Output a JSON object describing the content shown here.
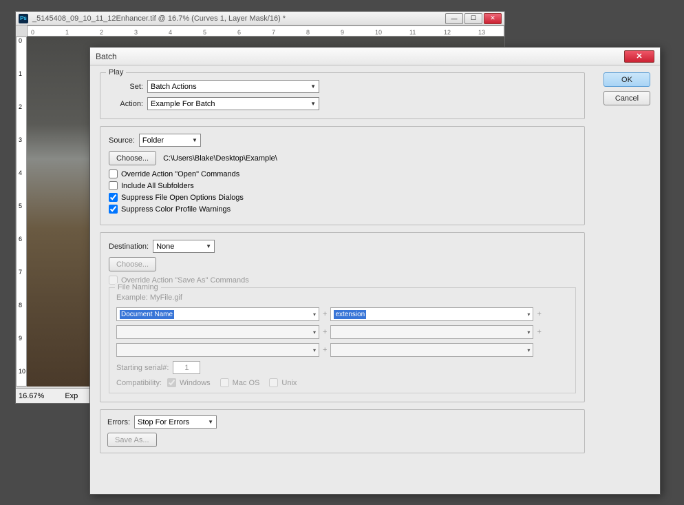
{
  "doc": {
    "title": "_5145408_09_10_11_12Enhancer.tif @ 16.7% (Curves 1, Layer Mask/16) *",
    "zoom": "16.67%",
    "status2": "Exp"
  },
  "ruler_h": [
    "0",
    "1",
    "2",
    "3",
    "4",
    "5",
    "6",
    "7",
    "8",
    "9",
    "10",
    "11",
    "12",
    "13"
  ],
  "ruler_v": [
    "0",
    "1",
    "2",
    "3",
    "4",
    "5",
    "6",
    "7",
    "8",
    "9",
    "10"
  ],
  "dlg": {
    "title": "Batch",
    "ok": "OK",
    "cancel": "Cancel",
    "play": {
      "legend": "Play",
      "set_label": "Set:",
      "set_value": "Batch Actions",
      "action_label": "Action:",
      "action_value": "Example For Batch"
    },
    "source": {
      "label": "Source:",
      "value": "Folder",
      "choose": "Choose...",
      "path": "C:\\Users\\Blake\\Desktop\\Example\\",
      "cb1": "Override Action \"Open\" Commands",
      "cb2": "Include All Subfolders",
      "cb3": "Suppress File Open Options Dialogs",
      "cb4": "Suppress Color Profile Warnings"
    },
    "dest": {
      "label": "Destination:",
      "value": "None",
      "choose": "Choose...",
      "cb1": "Override Action \"Save As\" Commands",
      "naming_legend": "File Naming",
      "example_label": "Example: MyFile.gif",
      "n1": "Document Name",
      "n2": "extension",
      "serial_label": "Starting serial#:",
      "serial_value": "1",
      "compat_label": "Compatibility:",
      "compat_win": "Windows",
      "compat_mac": "Mac OS",
      "compat_unix": "Unix"
    },
    "errors": {
      "label": "Errors:",
      "value": "Stop For Errors",
      "save": "Save As..."
    }
  }
}
